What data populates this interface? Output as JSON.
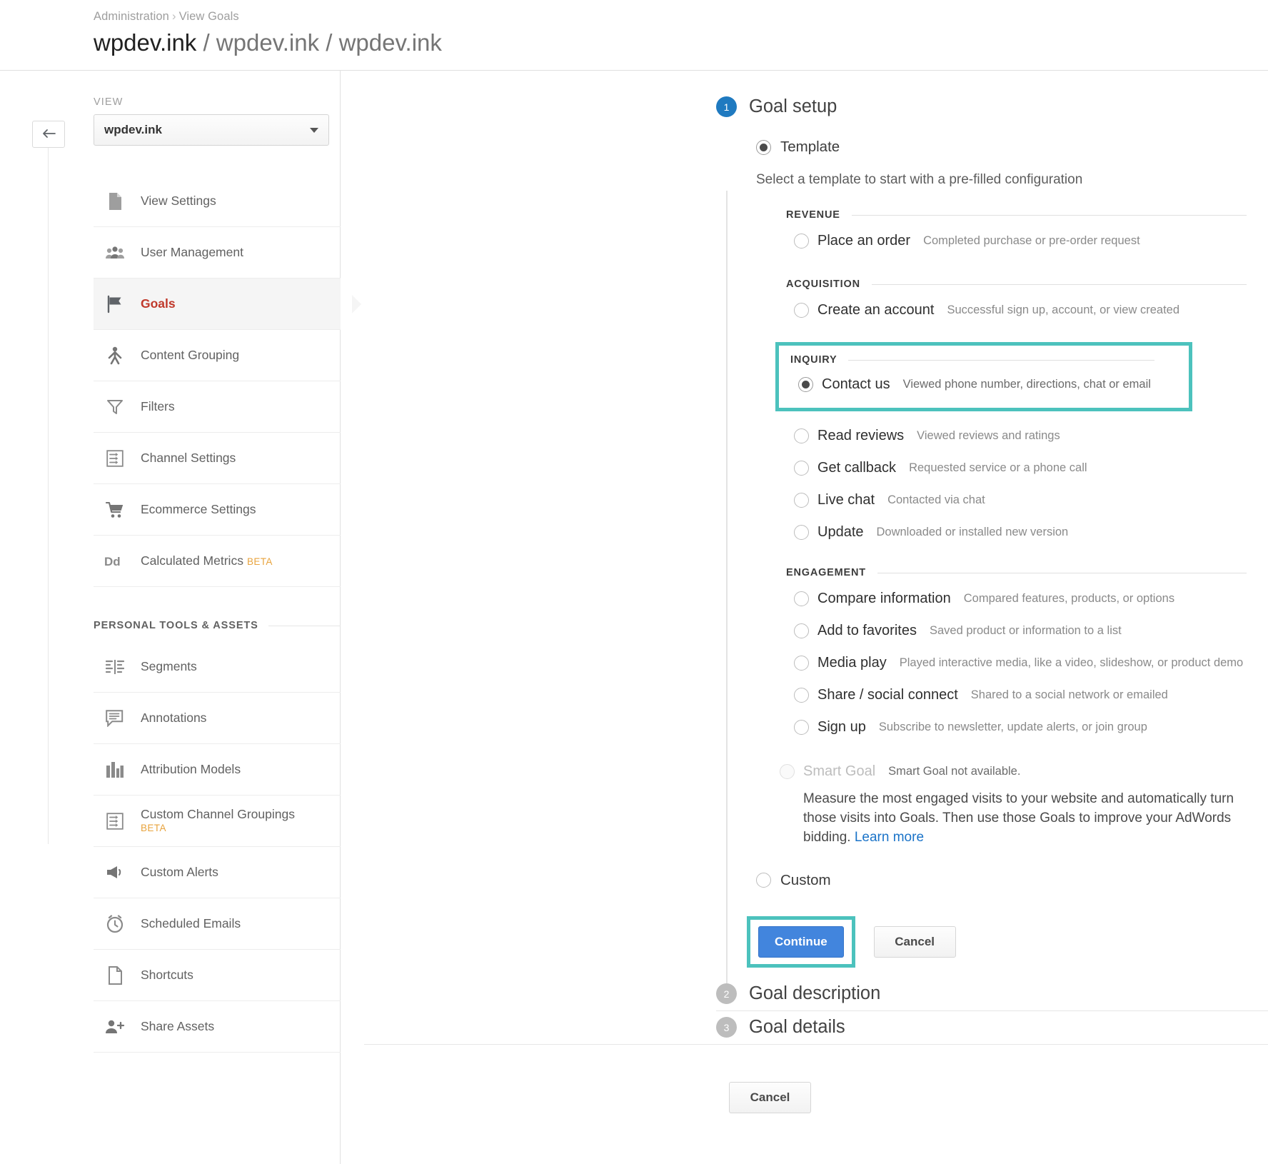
{
  "header": {
    "breadcrumb": [
      "Administration",
      "View Goals"
    ],
    "breadcrumb_separator": "›",
    "title_primary": "wpdev.ink",
    "title_rest": "/ wpdev.ink / wpdev.ink"
  },
  "sidebar": {
    "view_label": "VIEW",
    "view_value": "wpdev.ink",
    "items": [
      {
        "label": "View Settings",
        "icon": "document-icon",
        "active": false
      },
      {
        "label": "User Management",
        "icon": "users-icon",
        "active": false
      },
      {
        "label": "Goals",
        "icon": "flag-icon",
        "active": true
      },
      {
        "label": "Content Grouping",
        "icon": "person-grouping-icon",
        "active": false
      },
      {
        "label": "Filters",
        "icon": "funnel-icon",
        "active": false
      },
      {
        "label": "Channel Settings",
        "icon": "channel-icon",
        "active": false
      },
      {
        "label": "Ecommerce Settings",
        "icon": "cart-icon",
        "active": false
      },
      {
        "label": "Calculated Metrics",
        "icon": "dd-icon",
        "badge": "BETA",
        "active": false
      }
    ],
    "personal_section_title": "PERSONAL TOOLS & ASSETS",
    "personal_items": [
      {
        "label": "Segments",
        "icon": "segments-icon"
      },
      {
        "label": "Annotations",
        "icon": "annotation-icon"
      },
      {
        "label": "Attribution Models",
        "icon": "bar-chart-icon"
      },
      {
        "label": "Custom Channel Groupings",
        "icon": "channel-icon",
        "badge": "BETA"
      },
      {
        "label": "Custom Alerts",
        "icon": "megaphone-icon"
      },
      {
        "label": "Scheduled Emails",
        "icon": "clock-icon"
      },
      {
        "label": "Shortcuts",
        "icon": "page-icon"
      },
      {
        "label": "Share Assets",
        "icon": "share-person-icon"
      }
    ]
  },
  "main": {
    "steps": [
      {
        "number": "1",
        "title": "Goal setup",
        "state": "active"
      },
      {
        "number": "2",
        "title": "Goal description",
        "state": "inactive"
      },
      {
        "number": "3",
        "title": "Goal details",
        "state": "inactive"
      }
    ],
    "template_radio_label": "Template",
    "template_selected": true,
    "help_text": "Select a template to start with a pre-filled configuration",
    "groups": [
      {
        "title": "REVENUE",
        "highlighted": false,
        "options": [
          {
            "name": "Place an order",
            "desc": "Completed purchase or pre-order request",
            "selected": false
          }
        ]
      },
      {
        "title": "ACQUISITION",
        "highlighted": false,
        "options": [
          {
            "name": "Create an account",
            "desc": "Successful sign up, account, or view created",
            "selected": false
          }
        ]
      },
      {
        "title": "INQUIRY",
        "highlighted": true,
        "options": [
          {
            "name": "Contact us",
            "desc": "Viewed phone number, directions, chat or email",
            "selected": true
          }
        ]
      },
      {
        "title": "",
        "highlighted": false,
        "options": [
          {
            "name": "Read reviews",
            "desc": "Viewed reviews and ratings",
            "selected": false
          },
          {
            "name": "Get callback",
            "desc": "Requested service or a phone call",
            "selected": false
          },
          {
            "name": "Live chat",
            "desc": "Contacted via chat",
            "selected": false
          },
          {
            "name": "Update",
            "desc": "Downloaded or installed new version",
            "selected": false
          }
        ]
      },
      {
        "title": "ENGAGEMENT",
        "highlighted": false,
        "options": [
          {
            "name": "Compare information",
            "desc": "Compared features, products, or options",
            "selected": false
          },
          {
            "name": "Add to favorites",
            "desc": "Saved product or information to a list",
            "selected": false
          },
          {
            "name": "Media play",
            "desc": "Played interactive media, like a video, slideshow, or product demo",
            "selected": false
          },
          {
            "name": "Share / social connect",
            "desc": "Shared to a social network or emailed",
            "selected": false
          },
          {
            "name": "Sign up",
            "desc": "Subscribe to newsletter, update alerts, or join group",
            "selected": false
          }
        ]
      }
    ],
    "smart_goal": {
      "label": "Smart Goal",
      "status": "Smart Goal not available.",
      "description": "Measure the most engaged visits to your website and automatically turn those visits into Goals. Then use those Goals to improve your AdWords bidding.",
      "link_text": "Learn more",
      "disabled": true
    },
    "custom_radio_label": "Custom",
    "buttons": {
      "continue": "Continue",
      "cancel": "Cancel",
      "footer_cancel": "Cancel"
    }
  },
  "colors": {
    "accent_highlight": "#4cc2bd",
    "primary_button": "#4285dd",
    "active_nav": "#c0392b",
    "beta_badge": "#e8a33d",
    "step_active": "#1f7ac0",
    "link": "#1a73c8"
  }
}
